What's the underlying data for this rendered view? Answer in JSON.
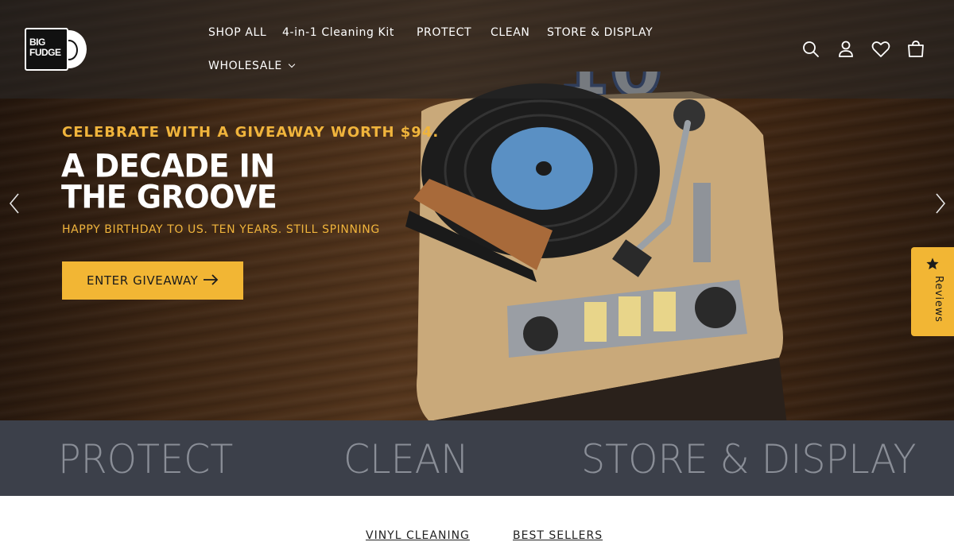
{
  "brand": {
    "logo_text": "BIG FUDGE"
  },
  "nav": {
    "items": [
      {
        "label": "SHOP ALL"
      },
      {
        "label": "4-in-1 Cleaning Kit"
      },
      {
        "label": "PROTECT"
      },
      {
        "label": "CLEAN"
      },
      {
        "label": "STORE & DISPLAY"
      },
      {
        "label": "WHOLESALE"
      }
    ],
    "icons": [
      "search-icon",
      "account-icon",
      "wishlist-icon",
      "cart-icon"
    ]
  },
  "hero": {
    "eyebrow": "CELEBRATE WITH A GIVEAWAY WORTH $94.",
    "headline_line1": "A DECADE IN",
    "headline_line2": "THE GROOVE",
    "subhead": "HAPPY BIRTHDAY TO US. TEN YEARS. STILL SPINNING",
    "cta_label": "ENTER GIVEAWAY",
    "cake_number": "10"
  },
  "reviews_tab": {
    "label": "Reviews"
  },
  "category_band": {
    "items": [
      {
        "label": "PROTECT"
      },
      {
        "label": "CLEAN"
      },
      {
        "label": "STORE & DISPLAY"
      }
    ]
  },
  "next_section": {
    "tabs": [
      {
        "label": "VINYL CLEANING"
      },
      {
        "label": "BEST SELLERS"
      }
    ]
  },
  "colors": {
    "accent": "#f2b634",
    "eyebrow": "#f0b43c",
    "band_bg": "#3c404a",
    "band_text": "#8a8e97"
  }
}
